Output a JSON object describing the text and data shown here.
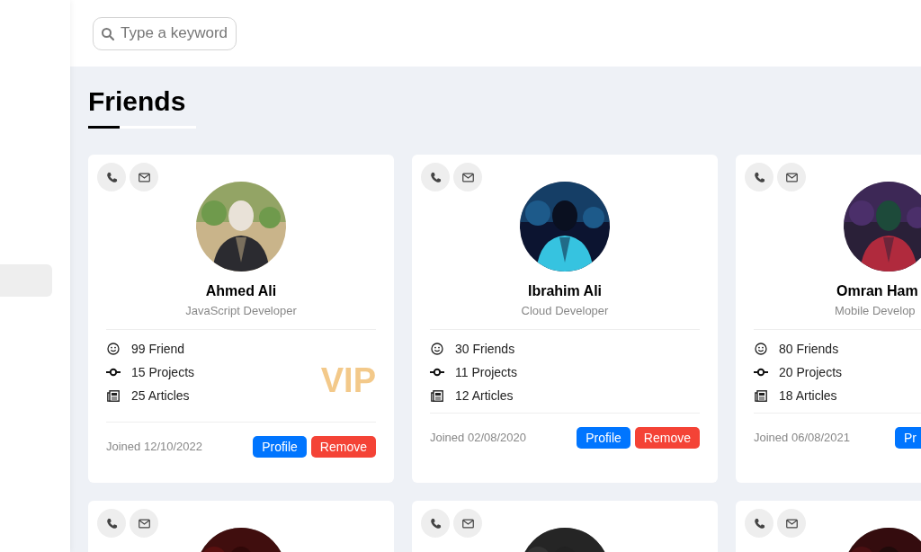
{
  "search": {
    "placeholder": "Type a keyword"
  },
  "page_title": "Friends",
  "cards": [
    {
      "name": "Ahmed Ali",
      "role": "JavaScript Developer",
      "badge": "VIP",
      "stats": [
        {
          "kind": "friends",
          "text": "99 Friend"
        },
        {
          "kind": "projects",
          "text": "15 Projects"
        },
        {
          "kind": "articles",
          "text": "25 Articles"
        }
      ],
      "joined": "Joined 12/10/2022",
      "buttons": [
        {
          "kind": "profile",
          "label": "Profile"
        },
        {
          "kind": "remove",
          "label": "Remove"
        }
      ]
    },
    {
      "name": "Ibrahim Ali",
      "role": "Cloud Developer",
      "stats": [
        {
          "kind": "friends",
          "text": "30 Friends"
        },
        {
          "kind": "projects",
          "text": "11 Projects"
        },
        {
          "kind": "articles",
          "text": "12 Articles"
        }
      ],
      "joined": "Joined 02/08/2020",
      "buttons": [
        {
          "kind": "profile",
          "label": "Profile"
        },
        {
          "kind": "remove",
          "label": "Remove"
        }
      ]
    },
    {
      "name": "Omran Ham",
      "role": "Mobile Develop",
      "stats": [
        {
          "kind": "friends",
          "text": "80 Friends"
        },
        {
          "kind": "projects",
          "text": "20 Projects"
        },
        {
          "kind": "articles",
          "text": "18 Articles"
        }
      ],
      "joined": "Joined 06/08/2021",
      "buttons": [
        {
          "kind": "profile",
          "label": "Pr"
        }
      ]
    },
    {
      "avatar": {
        "kind": "picture"
      }
    },
    {
      "avatar": {
        "kind": "picture"
      }
    },
    {
      "avatar": {
        "kind": "picture"
      }
    }
  ]
}
